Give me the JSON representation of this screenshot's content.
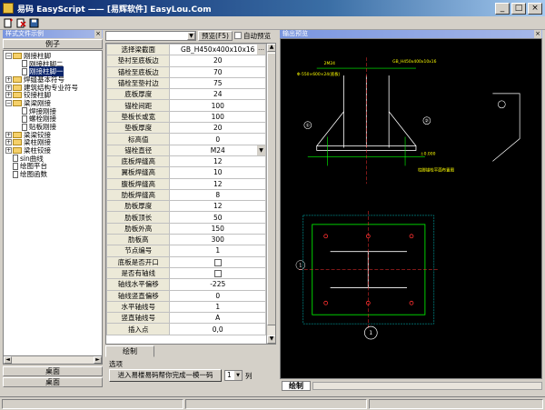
{
  "window": {
    "title": "易码 EasyScript —— [易辉软件] EasyLou.Com",
    "min": "_",
    "max": "□",
    "close": "×"
  },
  "left_panel": {
    "header": "样式文件示例",
    "close": "×",
    "example_button": "例子",
    "tree": [
      {
        "label": "刚接柱脚",
        "type": "folder",
        "level": 0,
        "expand": "−"
      },
      {
        "label": "刚接柱脚二",
        "type": "doc",
        "level": 1,
        "expand": ""
      },
      {
        "label": "刚接柱脚一",
        "type": "doc",
        "level": 1,
        "expand": "",
        "selected": true
      },
      {
        "label": "焊缝基本符号",
        "type": "folder",
        "level": 0,
        "expand": "+"
      },
      {
        "label": "建筑结构专业符号",
        "type": "folder",
        "level": 0,
        "expand": "+"
      },
      {
        "label": "铰接柱脚",
        "type": "folder",
        "level": 0,
        "expand": "+"
      },
      {
        "label": "梁梁刚接",
        "type": "folder",
        "level": 0,
        "expand": "−"
      },
      {
        "label": "焊接刚接",
        "type": "doc",
        "level": 1,
        "expand": ""
      },
      {
        "label": "螺栓刚接",
        "type": "doc",
        "level": 1,
        "expand": ""
      },
      {
        "label": "贴板刚接",
        "type": "doc",
        "level": 1,
        "expand": ""
      },
      {
        "label": "梁梁铰接",
        "type": "folder",
        "level": 0,
        "expand": "+"
      },
      {
        "label": "梁柱刚接",
        "type": "folder",
        "level": 0,
        "expand": "+"
      },
      {
        "label": "梁柱铰接",
        "type": "folder",
        "level": 0,
        "expand": "+"
      },
      {
        "label": "sin曲线",
        "type": "doc",
        "level": 0,
        "expand": ""
      },
      {
        "label": "绘图平台",
        "type": "doc",
        "level": 0,
        "expand": ""
      },
      {
        "label": "绘图函数",
        "type": "doc",
        "level": 0,
        "expand": ""
      }
    ],
    "bottom_tabs": [
      "桌面",
      "桌面"
    ]
  },
  "middle": {
    "combo_value": "",
    "preview_button": "预览(F5)",
    "auto_preview_label": "自动预览",
    "rows": [
      {
        "name": "选择梁截面",
        "value": "GB_H450x400x10x16",
        "kind": "ellipsis"
      },
      {
        "name": "垫衬至底板边",
        "value": "20",
        "kind": "text"
      },
      {
        "name": "锚栓至底板边",
        "value": "70",
        "kind": "text"
      },
      {
        "name": "锚栓至垫衬边",
        "value": "75",
        "kind": "text"
      },
      {
        "name": "底板厚度",
        "value": "24",
        "kind": "text"
      },
      {
        "name": "锚栓间距",
        "value": "100",
        "kind": "text"
      },
      {
        "name": "垫板长或宽",
        "value": "100",
        "kind": "text"
      },
      {
        "name": "垫板厚度",
        "value": "20",
        "kind": "text"
      },
      {
        "name": "标高值",
        "value": "0",
        "kind": "text"
      },
      {
        "name": "锚栓直径",
        "value": "M24",
        "kind": "dropdown"
      },
      {
        "name": "底板焊缝高",
        "value": "12",
        "kind": "text"
      },
      {
        "name": "翼板焊缝高",
        "value": "10",
        "kind": "text"
      },
      {
        "name": "腹板焊缝高",
        "value": "12",
        "kind": "text"
      },
      {
        "name": "肋板焊缝高",
        "value": "8",
        "kind": "text"
      },
      {
        "name": "肋板厚度",
        "value": "12",
        "kind": "text"
      },
      {
        "name": "肋板顶长",
        "value": "50",
        "kind": "text"
      },
      {
        "name": "肋板外高",
        "value": "150",
        "kind": "text"
      },
      {
        "name": "肋板高",
        "value": "300",
        "kind": "text"
      },
      {
        "name": "节点编号",
        "value": "1",
        "kind": "text"
      },
      {
        "name": "底板是否开口",
        "value": "",
        "kind": "checkbox"
      },
      {
        "name": "是否有轴线",
        "value": "",
        "kind": "checkbox"
      },
      {
        "name": "轴线水平偏移",
        "value": "-225",
        "kind": "text"
      },
      {
        "name": "轴线竖直偏移",
        "value": "0",
        "kind": "text"
      },
      {
        "name": "水平轴线号",
        "value": "1",
        "kind": "text"
      },
      {
        "name": "竖直轴线号",
        "value": "A",
        "kind": "text"
      },
      {
        "name": "插入点",
        "value": "0,0",
        "kind": "text"
      }
    ],
    "draw_tab": "绘制",
    "options_label": "选项",
    "enter_button": "进入易楼易码帮你完成一模一码",
    "columns_value": "1",
    "columns_label": "列"
  },
  "right_panel": {
    "header": "输出预览",
    "close": "×",
    "tab_label": "绘制",
    "drawing": {
      "elev_label": "±0.000",
      "beam_label": "GB_H450x400x10x16",
      "bolt_label": "2M24",
      "plate_label": "Φ-550×600×24(底板)",
      "note_label": "±0.000",
      "detail_label": "1",
      "section_label": "柱脚锚栓平面布置图",
      "node_number": "1",
      "callout_left": "①",
      "callout_right": "②"
    },
    "colors": {
      "background": "#000000",
      "steel": "#ffffff",
      "dims": "#00ff00",
      "text": "#ffff00",
      "axis": "#ff3030",
      "section": "#00ffff"
    }
  }
}
